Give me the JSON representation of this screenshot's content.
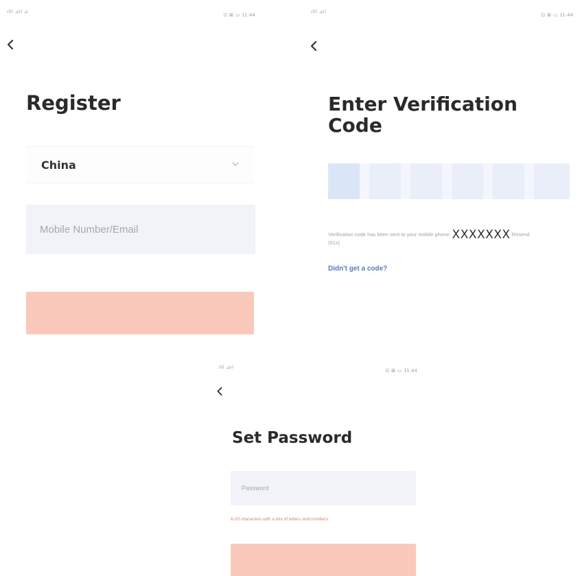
{
  "colors": {
    "button_disabled": "#fbc8bc",
    "input_bg": "#f1f3f9",
    "link": "#4f7fc4",
    "hint": "#d08a76"
  },
  "screens": [
    {
      "status_left": "ılıl ⊿ıl ⊿",
      "status_right": "⊡ ⊠ ▭ 11:44",
      "back_icon": "chevron-left-icon",
      "title": "Register",
      "country": "China",
      "dropdown_icon": "chevron-down-icon",
      "input_placeholder": "Mobile Number/Email",
      "button_label": ""
    },
    {
      "status_left": "ılıl ⊿ıl",
      "status_right": "⊡ ⊠ ▭ 11:44",
      "back_icon": "chevron-left-icon",
      "title": "Enter Verification Code",
      "code_message_before": "Verification code has been sent to your mobile phone:",
      "code_phone": "XXXXXXX",
      "code_message_after": "Resend (51s)",
      "resend_link": "Didn't get a code?"
    },
    {
      "status_left": "ılıl ⊿ıl",
      "status_right": "⊡ ⊠ ▭ 11:44",
      "back_icon": "chevron-left-icon",
      "title": "Set Password",
      "input_placeholder": "Password",
      "hint": "6-20 characters with a mix of letters and numbers",
      "button_label": ""
    }
  ]
}
